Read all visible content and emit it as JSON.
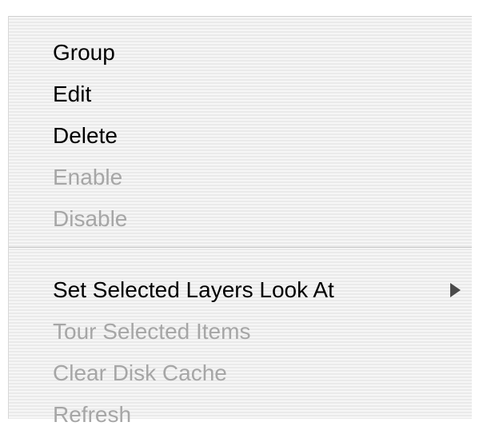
{
  "context_menu": {
    "group1": [
      {
        "label": "Group",
        "enabled": true
      },
      {
        "label": "Edit",
        "enabled": true
      },
      {
        "label": "Delete",
        "enabled": true
      },
      {
        "label": "Enable",
        "enabled": false
      },
      {
        "label": "Disable",
        "enabled": false
      }
    ],
    "group2": [
      {
        "label": "Set Selected Layers Look At",
        "enabled": true,
        "submenu": true
      },
      {
        "label": "Tour Selected Items",
        "enabled": false
      },
      {
        "label": "Clear Disk Cache",
        "enabled": false
      },
      {
        "label": "Refresh",
        "enabled": false
      }
    ]
  },
  "colors": {
    "enabled_text": "#000000",
    "disabled_text": "#a6a6a6",
    "menu_background": "#f4f4f4"
  },
  "icons": {
    "submenu_arrow": "triangle-right-icon"
  }
}
